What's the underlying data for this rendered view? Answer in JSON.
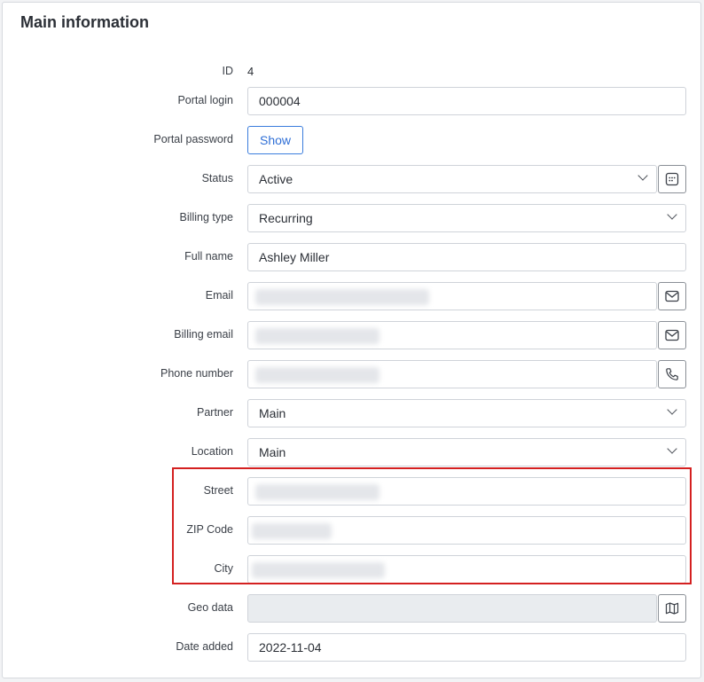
{
  "section": {
    "title": "Main information"
  },
  "fields": {
    "id": {
      "label": "ID",
      "value": "4"
    },
    "portal_login": {
      "label": "Portal login",
      "value": "000004"
    },
    "portal_password": {
      "label": "Portal password",
      "button": "Show"
    },
    "status": {
      "label": "Status",
      "value": "Active"
    },
    "billing_type": {
      "label": "Billing type",
      "value": "Recurring"
    },
    "full_name": {
      "label": "Full name",
      "value": "Ashley Miller"
    },
    "email": {
      "label": "Email"
    },
    "billing_email": {
      "label": "Billing email"
    },
    "phone_number": {
      "label": "Phone number"
    },
    "partner": {
      "label": "Partner",
      "value": "Main"
    },
    "location": {
      "label": "Location",
      "value": "Main"
    },
    "street": {
      "label": "Street"
    },
    "zip_code": {
      "label": "ZIP Code"
    },
    "city": {
      "label": "City"
    },
    "geo_data": {
      "label": "Geo data"
    },
    "date_added": {
      "label": "Date added",
      "value": "2022-11-04"
    }
  },
  "icons": {
    "status_addon": "calendar-icon",
    "email_addon": "mail-icon",
    "billing_email_addon": "mail-icon",
    "phone_addon": "phone-icon",
    "geo_addon": "map-icon"
  },
  "colors": {
    "accent": "#3b7ddd",
    "highlight": "#d42020",
    "disabled": "#e9ecef"
  }
}
